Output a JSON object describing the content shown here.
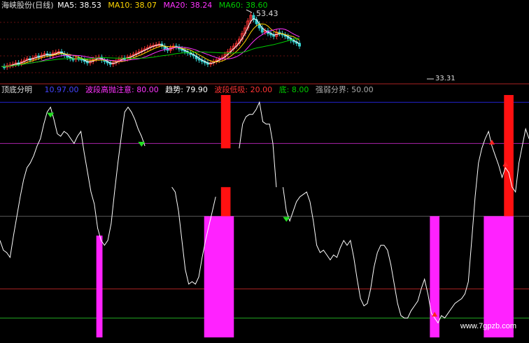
{
  "top_panel": {
    "name": "海峡股份(日线)",
    "ma5_label": "MA5:",
    "ma5_value": "38.53",
    "ma10_label": "MA10:",
    "ma10_value": "38.07",
    "ma20_label": "MA20:",
    "ma20_value": "38.24",
    "ma60_label": "MA60:",
    "ma60_value": "38.60",
    "high_label": "53.43",
    "low_label": "33.31",
    "colors": {
      "ma5": "#ffffff",
      "ma10": "#ffd700",
      "ma20": "#ff33ff",
      "ma60": "#00cc00",
      "up": "#ff3333",
      "down": "#33cccc"
    }
  },
  "indicator": {
    "name": "顶底分明",
    "v1_value": "10.97.00",
    "top_alert_label": "波段高抛注意:",
    "top_alert_value": "80.00",
    "trend_label": "趋势:",
    "trend_value": "79.90",
    "bottom_buy_label": "波段低吸:",
    "bottom_buy_value": "20.00",
    "floor_label": "底:",
    "floor_value": "8.00",
    "strength_label": "强弱分界:",
    "strength_value": "50.00",
    "colors": {
      "name": "#dddddd",
      "v1": "#4444ff",
      "top_alert": "#ff33ff",
      "trend": "#ffffff",
      "bottom_buy": "#ff3333",
      "floor": "#00cc00",
      "strength": "#aaaaaa",
      "bar_magenta": "#ff22ff",
      "bar_red": "#ff1111"
    }
  },
  "watermark": "www.7gpzb.com",
  "chart_data": {
    "type": "line",
    "title": "顶底分明",
    "ylim": [
      0,
      100
    ],
    "reference_lines": [
      {
        "name": "波段高抛注意",
        "value": 80,
        "color": "#aa22aa"
      },
      {
        "name": "强弱分界",
        "value": 50,
        "color": "#555555"
      },
      {
        "name": "波段低吸",
        "value": 20,
        "color": "#aa2222"
      },
      {
        "name": "底",
        "value": 8,
        "color": "#22aa22"
      },
      {
        "name": "blue-top",
        "value": 97,
        "color": "#2222cc"
      }
    ],
    "series": [
      {
        "values": [
          40,
          36,
          35,
          33,
          42,
          50,
          58,
          65,
          70,
          72,
          75,
          79,
          82,
          88,
          93,
          95,
          90,
          84,
          83,
          85,
          84,
          82,
          80,
          83,
          85,
          76,
          68,
          60,
          55,
          45,
          40,
          38,
          40,
          47,
          60,
          72,
          83,
          93,
          95,
          93,
          90,
          86,
          83,
          79,
          null,
          null,
          null,
          null,
          null,
          null,
          null,
          62,
          60,
          52,
          40,
          28,
          22,
          23,
          22,
          25,
          33,
          40,
          46,
          52,
          58,
          null,
          null,
          null,
          null,
          null,
          null,
          78,
          88,
          91,
          92,
          92,
          94,
          97,
          89,
          88,
          88,
          80,
          62,
          null,
          62,
          52,
          48,
          52,
          56,
          58,
          59,
          60,
          56,
          48,
          38,
          35,
          36,
          34,
          32,
          34,
          33,
          37,
          40,
          38,
          40,
          33,
          24,
          16,
          13,
          14,
          20,
          29,
          35,
          38,
          38,
          36,
          30,
          22,
          14,
          9,
          8,
          8,
          11,
          13,
          15,
          20,
          24,
          18,
          10,
          8,
          6,
          9,
          8,
          10,
          12,
          14,
          15,
          16,
          18,
          23,
          40,
          58,
          72,
          78,
          82,
          85,
          79,
          75,
          71,
          66,
          70,
          68,
          62,
          60,
          72,
          79,
          86,
          82
        ]
      }
    ],
    "bars": [
      {
        "from": 29,
        "to": 30,
        "low": 0,
        "high": 42,
        "color": "magenta"
      },
      {
        "from": 61,
        "to": 69,
        "low": 0,
        "high": 50,
        "color": "magenta"
      },
      {
        "from": 66,
        "to": 68,
        "low": 50,
        "high": 62,
        "color": "red"
      },
      {
        "from": 66,
        "to": 68,
        "low": 78,
        "high": 100,
        "color": "red"
      },
      {
        "from": 128,
        "to": 130,
        "low": 0,
        "high": 50,
        "color": "magenta"
      },
      {
        "from": 144,
        "to": 152,
        "low": 0,
        "high": 50,
        "color": "magenta"
      },
      {
        "from": 150,
        "to": 152,
        "low": 50,
        "high": 100,
        "color": "red"
      }
    ],
    "sell_marks": [
      15,
      42,
      85
    ],
    "buy_marks": [
      129,
      146,
      150
    ]
  }
}
